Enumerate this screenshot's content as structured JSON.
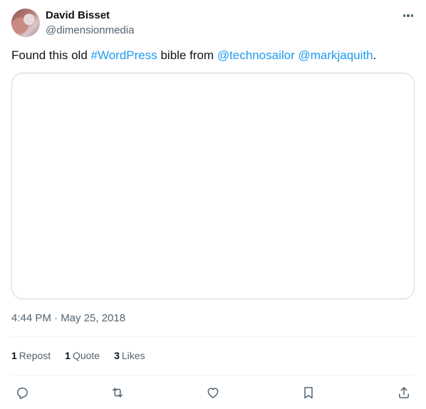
{
  "author": {
    "name": "David Bisset",
    "handle": "@dimensionmedia"
  },
  "tweet": {
    "text_prefix": "Found this old ",
    "hashtag": "#WordPress",
    "text_middle": " bible from ",
    "mention_1": "@technosailor",
    "mention_2": "@markjaquith",
    "text_suffix": "."
  },
  "timestamp": "4:44 PM · May 25, 2018",
  "stats": {
    "reposts_count": "1",
    "reposts_label": "Repost",
    "quotes_count": "1",
    "quotes_label": "Quote",
    "likes_count": "3",
    "likes_label": "Likes"
  },
  "icons": {
    "more": "more-icon",
    "reply": "reply-icon",
    "repost": "repost-icon",
    "like": "heart-icon",
    "bookmark": "bookmark-icon",
    "share": "share-icon"
  },
  "colors": {
    "link": "#1d9bf0",
    "text": "#0f1419",
    "secondary": "#536471",
    "border": "#cfd9de"
  }
}
